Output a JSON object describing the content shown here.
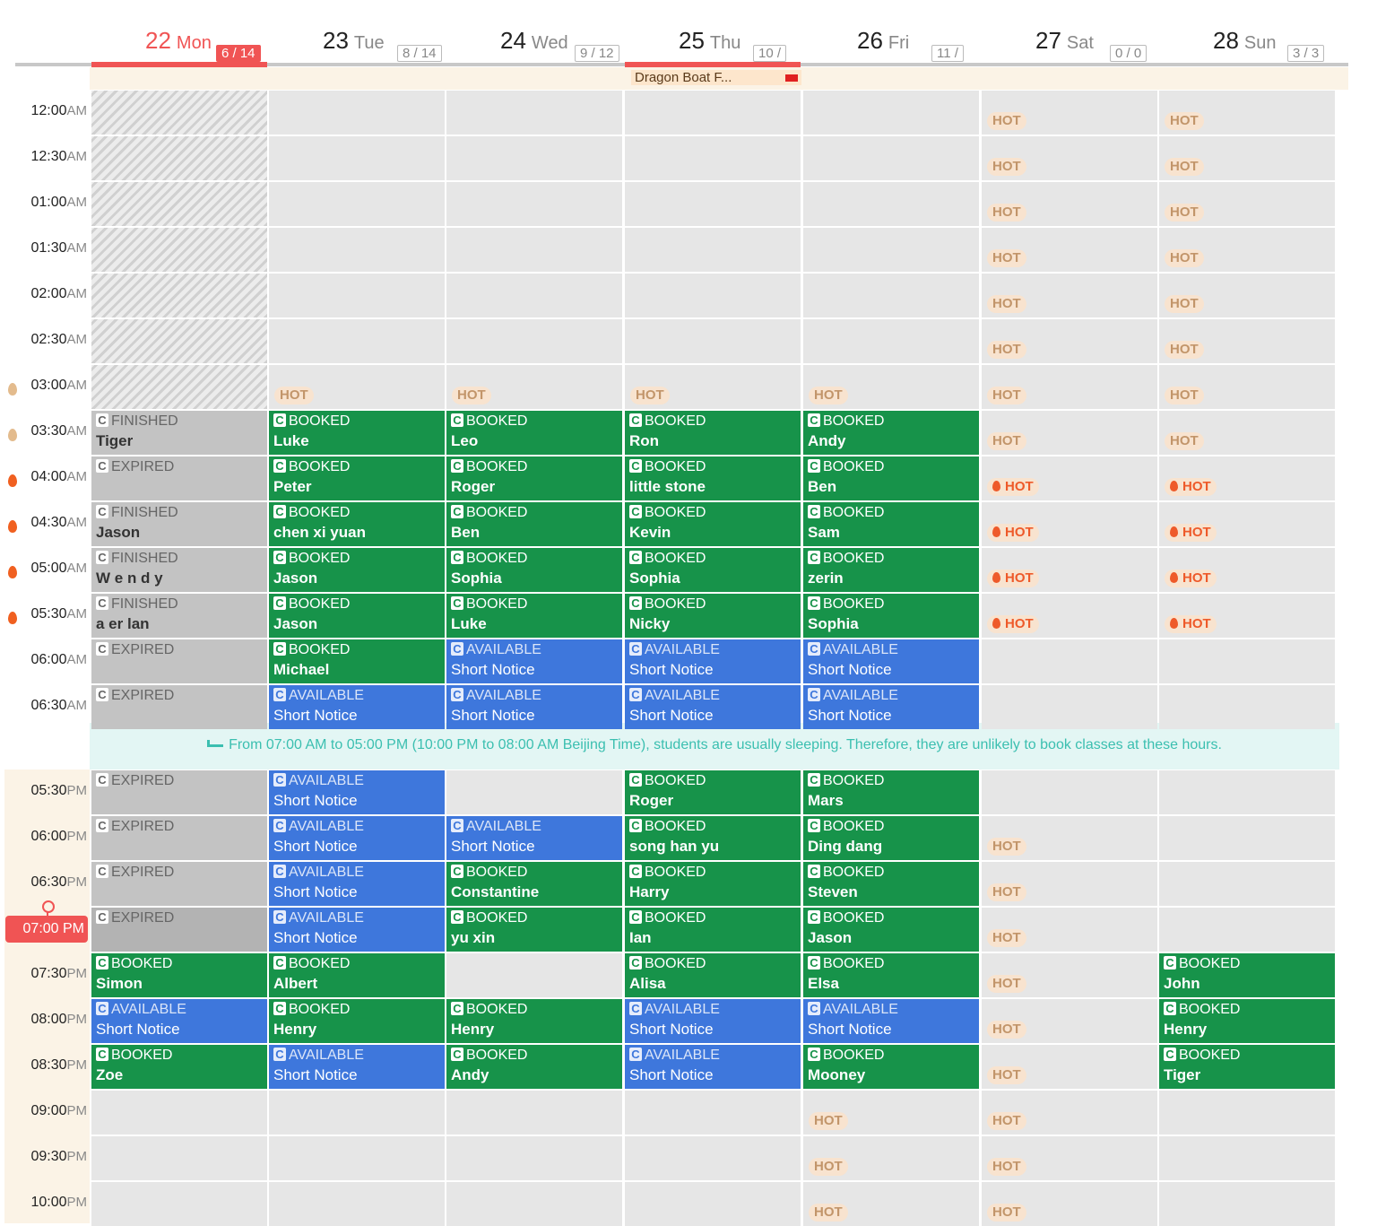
{
  "days": [
    {
      "num": "22",
      "wd": "Mon",
      "badge": "6 / 14",
      "today": true
    },
    {
      "num": "23",
      "wd": "Tue",
      "badge": "8 / 14"
    },
    {
      "num": "24",
      "wd": "Wed",
      "badge": "9 / 12"
    },
    {
      "num": "25",
      "wd": "Thu",
      "badge": "10 /",
      "red": true
    },
    {
      "num": "26",
      "wd": "Fri",
      "badge": "11 /"
    },
    {
      "num": "27",
      "wd": "Sat",
      "badge": "0 / 0"
    },
    {
      "num": "28",
      "wd": "Sun",
      "badge": "3 / 3"
    }
  ],
  "holiday": "Dragon Boat F...",
  "current_time": "07:00 PM",
  "notice": "From 07:00 AM to 05:00 PM (10:00 PM to 08:00 AM Beijing Time), students are usually sleeping. Therefore, they are unlikely to book classes at these hours.",
  "hot_label": "HOT",
  "am_rows": [
    {
      "time": "12:00",
      "ap": "AM",
      "cells": [
        {
          "t": "hatched"
        },
        {},
        {},
        {},
        {},
        {
          "hot": "light"
        },
        {
          "hot": "light"
        }
      ]
    },
    {
      "time": "12:30",
      "ap": "AM",
      "cells": [
        {
          "t": "hatched"
        },
        {},
        {},
        {},
        {},
        {
          "hot": "light"
        },
        {
          "hot": "light"
        }
      ]
    },
    {
      "time": "01:00",
      "ap": "AM",
      "cells": [
        {
          "t": "hatched"
        },
        {},
        {},
        {},
        {},
        {
          "hot": "light"
        },
        {
          "hot": "light"
        }
      ]
    },
    {
      "time": "01:30",
      "ap": "AM",
      "cells": [
        {
          "t": "hatched"
        },
        {},
        {},
        {},
        {},
        {
          "hot": "light"
        },
        {
          "hot": "light"
        }
      ]
    },
    {
      "time": "02:00",
      "ap": "AM",
      "cells": [
        {
          "t": "hatched"
        },
        {},
        {},
        {},
        {},
        {
          "hot": "light"
        },
        {
          "hot": "light"
        }
      ]
    },
    {
      "time": "02:30",
      "ap": "AM",
      "cells": [
        {
          "t": "hatched"
        },
        {},
        {},
        {},
        {},
        {
          "hot": "light"
        },
        {
          "hot": "light"
        }
      ]
    },
    {
      "time": "03:00",
      "ap": "AM",
      "dot": "light",
      "cells": [
        {
          "t": "hatched"
        },
        {
          "hot": "light"
        },
        {
          "hot": "light"
        },
        {
          "hot": "light"
        },
        {
          "hot": "light"
        },
        {
          "hot": "light"
        },
        {
          "hot": "light"
        }
      ]
    },
    {
      "time": "03:30",
      "ap": "AM",
      "dot": "light",
      "cells": [
        {
          "t": "fin",
          "s": "FINISHED",
          "n": "Tiger"
        },
        {
          "t": "booked",
          "s": "BOOKED",
          "n": "Luke"
        },
        {
          "t": "booked",
          "s": "BOOKED",
          "n": "Leo"
        },
        {
          "t": "booked",
          "s": "BOOKED",
          "n": "Ron"
        },
        {
          "t": "booked",
          "s": "BOOKED",
          "n": "Andy"
        },
        {
          "hot": "light"
        },
        {
          "hot": "light"
        }
      ]
    },
    {
      "time": "04:00",
      "ap": "AM",
      "dot": "red",
      "cells": [
        {
          "t": "exp",
          "s": "EXPIRED"
        },
        {
          "t": "booked",
          "s": "BOOKED",
          "n": "Peter"
        },
        {
          "t": "booked",
          "s": "BOOKED",
          "n": "Roger"
        },
        {
          "t": "booked",
          "s": "BOOKED",
          "n": "little stone"
        },
        {
          "t": "booked",
          "s": "BOOKED",
          "n": "Ben"
        },
        {
          "hot": "red"
        },
        {
          "hot": "red"
        }
      ]
    },
    {
      "time": "04:30",
      "ap": "AM",
      "dot": "red",
      "cells": [
        {
          "t": "fin",
          "s": "FINISHED",
          "n": "Jason"
        },
        {
          "t": "booked",
          "s": "BOOKED",
          "n": "chen xi yuan"
        },
        {
          "t": "booked",
          "s": "BOOKED",
          "n": "Ben"
        },
        {
          "t": "booked",
          "s": "BOOKED",
          "n": "Kevin"
        },
        {
          "t": "booked",
          "s": "BOOKED",
          "n": "Sam"
        },
        {
          "hot": "red"
        },
        {
          "hot": "red"
        }
      ]
    },
    {
      "time": "05:00",
      "ap": "AM",
      "dot": "red",
      "cells": [
        {
          "t": "fin",
          "s": "FINISHED",
          "n": "W e n d y"
        },
        {
          "t": "booked",
          "s": "BOOKED",
          "n": "Jason"
        },
        {
          "t": "booked",
          "s": "BOOKED",
          "n": "Sophia"
        },
        {
          "t": "booked",
          "s": "BOOKED",
          "n": "Sophia"
        },
        {
          "t": "booked",
          "s": "BOOKED",
          "n": "zerin"
        },
        {
          "hot": "red"
        },
        {
          "hot": "red"
        }
      ]
    },
    {
      "time": "05:30",
      "ap": "AM",
      "dot": "red",
      "cells": [
        {
          "t": "fin",
          "s": "FINISHED",
          "n": "a er lan"
        },
        {
          "t": "booked",
          "s": "BOOKED",
          "n": "Jason"
        },
        {
          "t": "booked",
          "s": "BOOKED",
          "n": "Luke"
        },
        {
          "t": "booked",
          "s": "BOOKED",
          "n": "Nicky"
        },
        {
          "t": "booked",
          "s": "BOOKED",
          "n": "Sophia"
        },
        {
          "hot": "red"
        },
        {
          "hot": "red"
        }
      ]
    },
    {
      "time": "06:00",
      "ap": "AM",
      "cells": [
        {
          "t": "exp",
          "s": "EXPIRED"
        },
        {
          "t": "booked",
          "s": "BOOKED",
          "n": "Michael"
        },
        {
          "t": "avail",
          "s": "AVAILABLE",
          "n": "Short Notice"
        },
        {
          "t": "avail",
          "s": "AVAILABLE",
          "n": "Short Notice"
        },
        {
          "t": "avail",
          "s": "AVAILABLE",
          "n": "Short Notice"
        },
        {},
        {}
      ]
    },
    {
      "time": "06:30",
      "ap": "AM",
      "cells": [
        {
          "t": "exp",
          "s": "EXPIRED"
        },
        {
          "t": "avail",
          "s": "AVAILABLE",
          "n": "Short Notice"
        },
        {
          "t": "avail",
          "s": "AVAILABLE",
          "n": "Short Notice"
        },
        {
          "t": "avail",
          "s": "AVAILABLE",
          "n": "Short Notice"
        },
        {
          "t": "avail",
          "s": "AVAILABLE",
          "n": "Short Notice"
        },
        {},
        {}
      ]
    }
  ],
  "pm_rows": [
    {
      "time": "05:30",
      "ap": "PM",
      "cells": [
        {
          "t": "exp",
          "s": "EXPIRED"
        },
        {
          "t": "avail",
          "s": "AVAILABLE",
          "n": "Short Notice"
        },
        {},
        {
          "t": "booked",
          "s": "BOOKED",
          "n": "Roger"
        },
        {
          "t": "booked",
          "s": "BOOKED",
          "n": "Mars"
        },
        {},
        {}
      ]
    },
    {
      "time": "06:00",
      "ap": "PM",
      "cells": [
        {
          "t": "exp",
          "s": "EXPIRED"
        },
        {
          "t": "avail",
          "s": "AVAILABLE",
          "n": "Short Notice"
        },
        {
          "t": "avail",
          "s": "AVAILABLE",
          "n": "Short Notice"
        },
        {
          "t": "booked",
          "s": "BOOKED",
          "n": "song han yu"
        },
        {
          "t": "booked",
          "s": "BOOKED",
          "n": "Ding dang"
        },
        {
          "hot": "light"
        },
        {}
      ]
    },
    {
      "time": "06:30",
      "ap": "PM",
      "cells": [
        {
          "t": "exp",
          "s": "EXPIRED"
        },
        {
          "t": "avail",
          "s": "AVAILABLE",
          "n": "Short Notice"
        },
        {
          "t": "booked",
          "s": "BOOKED",
          "n": "Constantine"
        },
        {
          "t": "booked",
          "s": "BOOKED",
          "n": "Harry"
        },
        {
          "t": "booked",
          "s": "BOOKED",
          "n": "Steven"
        },
        {
          "hot": "light"
        },
        {}
      ]
    },
    {
      "time": "07:00",
      "ap": "PM",
      "now": true,
      "cells": [
        {
          "t": "sel",
          "s": "EXPIRED"
        },
        {
          "t": "avail",
          "s": "AVAILABLE",
          "n": "Short Notice"
        },
        {
          "t": "booked",
          "s": "BOOKED",
          "n": "yu xin"
        },
        {
          "t": "booked",
          "s": "BOOKED",
          "n": "Ian"
        },
        {
          "t": "booked",
          "s": "BOOKED",
          "n": "Jason"
        },
        {
          "hot": "light"
        },
        {}
      ]
    },
    {
      "time": "07:30",
      "ap": "PM",
      "cells": [
        {
          "t": "booked",
          "s": "BOOKED",
          "n": "Simon"
        },
        {
          "t": "booked",
          "s": "BOOKED",
          "n": "Albert"
        },
        {},
        {
          "t": "booked",
          "s": "BOOKED",
          "n": "Alisa"
        },
        {
          "t": "booked",
          "s": "BOOKED",
          "n": "Elsa"
        },
        {
          "hot": "light"
        },
        {
          "t": "booked",
          "s": "BOOKED",
          "n": "John"
        }
      ]
    },
    {
      "time": "08:00",
      "ap": "PM",
      "cells": [
        {
          "t": "avail",
          "s": "AVAILABLE",
          "n": "Short Notice"
        },
        {
          "t": "booked",
          "s": "BOOKED",
          "n": "Henry"
        },
        {
          "t": "booked",
          "s": "BOOKED",
          "n": "Henry"
        },
        {
          "t": "avail",
          "s": "AVAILABLE",
          "n": "Short Notice"
        },
        {
          "t": "avail",
          "s": "AVAILABLE",
          "n": "Short Notice"
        },
        {
          "hot": "light"
        },
        {
          "t": "booked",
          "s": "BOOKED",
          "n": "Henry"
        }
      ]
    },
    {
      "time": "08:30",
      "ap": "PM",
      "cells": [
        {
          "t": "booked",
          "s": "BOOKED",
          "n": "Zoe"
        },
        {
          "t": "avail",
          "s": "AVAILABLE",
          "n": "Short Notice"
        },
        {
          "t": "booked",
          "s": "BOOKED",
          "n": "Andy"
        },
        {
          "t": "avail",
          "s": "AVAILABLE",
          "n": "Short Notice"
        },
        {
          "t": "booked",
          "s": "BOOKED",
          "n": "Mooney"
        },
        {
          "hot": "light"
        },
        {
          "t": "booked",
          "s": "BOOKED",
          "n": "Tiger"
        }
      ]
    },
    {
      "time": "09:00",
      "ap": "PM",
      "cells": [
        {},
        {},
        {},
        {},
        {
          "hot": "light"
        },
        {
          "hot": "light"
        },
        {}
      ]
    },
    {
      "time": "09:30",
      "ap": "PM",
      "cells": [
        {},
        {},
        {},
        {},
        {
          "hot": "light"
        },
        {
          "hot": "light"
        },
        {}
      ]
    },
    {
      "time": "10:00",
      "ap": "PM",
      "cells": [
        {},
        {},
        {},
        {},
        {
          "hot": "light"
        },
        {
          "hot": "light"
        },
        {}
      ]
    }
  ]
}
